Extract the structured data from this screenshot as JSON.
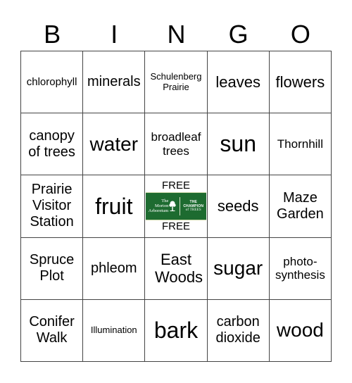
{
  "header": {
    "letters": [
      "B",
      "I",
      "N",
      "G",
      "O"
    ]
  },
  "board": {
    "rows": [
      [
        "chlorophyll",
        "minerals",
        "Schulenberg Prairie",
        "leaves",
        "flowers"
      ],
      [
        "canopy of trees",
        "water",
        "broadleaf trees",
        "sun",
        "Thornhill"
      ],
      [
        "Prairie Visitor Station",
        "fruit",
        "FREE",
        "seeds",
        "Maze Garden"
      ],
      [
        "Spruce Plot",
        "phleom",
        "East Woods",
        "sugar",
        "photo-synthesis"
      ],
      [
        "Conifer Walk",
        "Illumination",
        "bark",
        "carbon dioxide",
        "wood"
      ]
    ],
    "free_space": {
      "top_label": "FREE",
      "bottom_label": "FREE",
      "logo": {
        "org_line1": "The",
        "org_line2": "Morton",
        "org_line3": "Arboretum",
        "tagline_line1": "THE",
        "tagline_line2": "CHAMPION",
        "tagline_line3": "of TREES",
        "icon": "tree-icon",
        "bg_color": "#1d6b30"
      }
    }
  },
  "colors": {
    "grid_line": "#444444",
    "text": "#000000",
    "background": "#ffffff"
  }
}
